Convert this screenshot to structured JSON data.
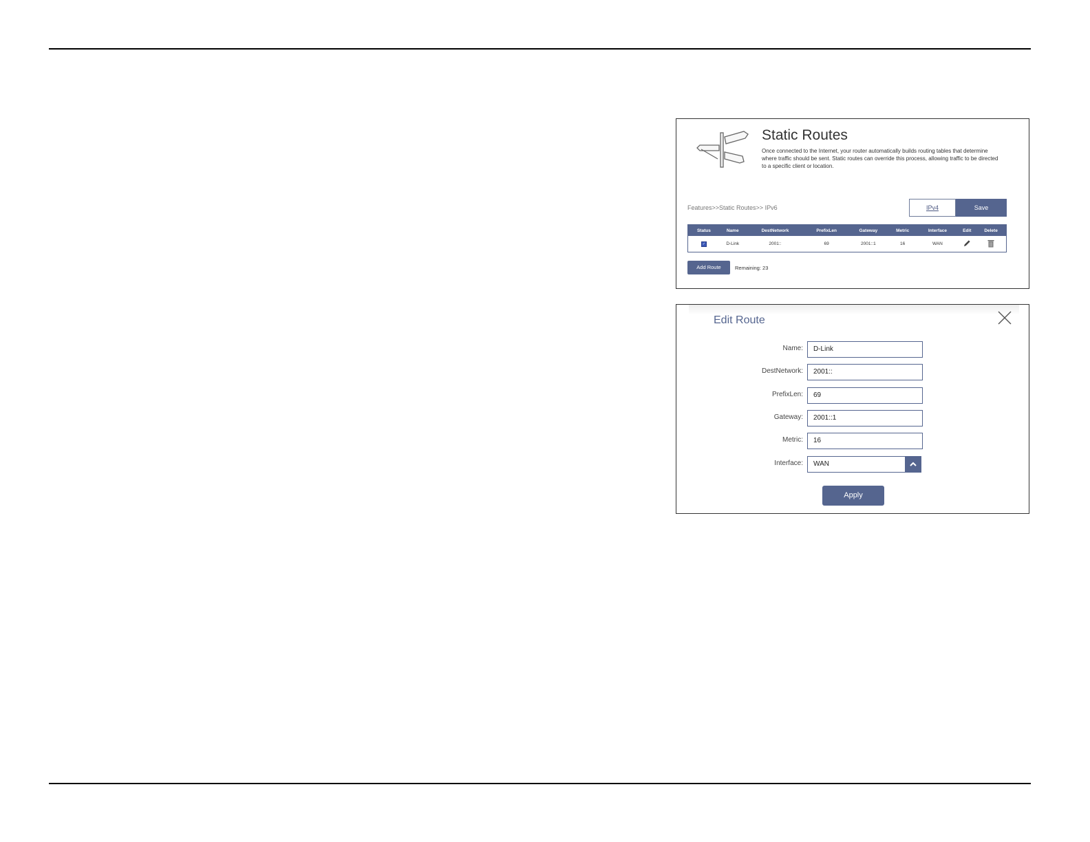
{
  "static_routes": {
    "title": "Static Routes",
    "description": "Once connected to the Internet, your router automatically builds routing tables that determine where traffic should be sent. Static routes can override this process, allowing traffic to be directed to a specific client or location.",
    "breadcrumb": "Features>>Static Routes>> IPv6",
    "ipv4_label": "IPv4",
    "save_label": "Save",
    "columns": [
      "Status",
      "Name",
      "DestNetwork",
      "PrefixLen",
      "Gateway",
      "Metric",
      "Interface",
      "Edit",
      "Delete"
    ],
    "rows": [
      {
        "status_checked": true,
        "name": "D-Link",
        "dest": "2001::",
        "prefix": "69",
        "gateway": "2001::1",
        "metric": "16",
        "interface": "WAN"
      }
    ],
    "add_route_label": "Add Route",
    "remaining_text": "Remaining: 23",
    "icons": {
      "logo": "signpost-icon",
      "edit": "pencil-icon",
      "delete": "trash-icon",
      "status": "checkbox-checked-icon"
    }
  },
  "edit_route": {
    "title": "Edit Route",
    "fields": {
      "name_label": "Name:",
      "name_value": "D-Link",
      "dest_label": "DestNetwork:",
      "dest_value": "2001::",
      "prefix_label": "PrefixLen:",
      "prefix_value": "69",
      "gateway_label": "Gateway:",
      "gateway_value": "2001::1",
      "metric_label": "Metric:",
      "metric_value": "16",
      "interface_label": "Interface:",
      "interface_value": "WAN"
    },
    "apply_label": "Apply",
    "icons": {
      "close": "close-icon",
      "dropdown": "chevron-up-icon"
    }
  },
  "colors": {
    "accent": "#55658f",
    "text": "#333333",
    "rule": "#000000"
  }
}
